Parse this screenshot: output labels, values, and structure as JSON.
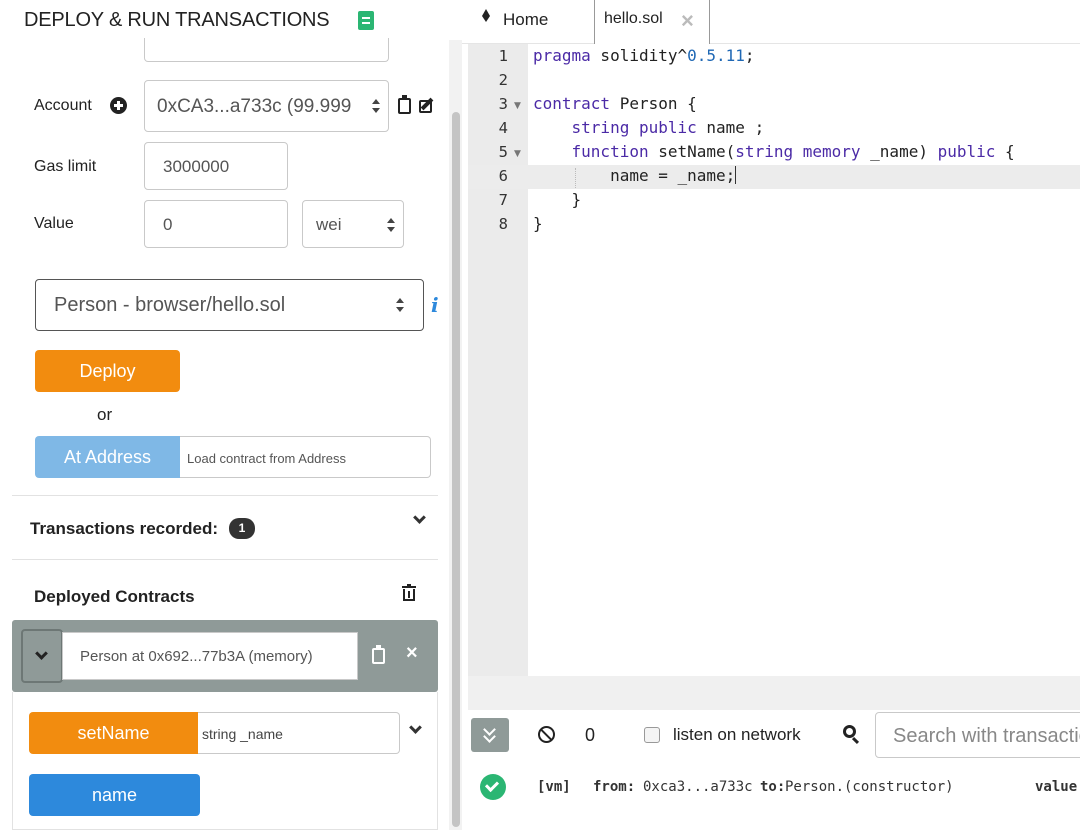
{
  "panel": {
    "title": "DEPLOY & RUN TRANSACTIONS",
    "account_label": "Account",
    "account_value": "0xCA3...a733c (99.999",
    "gas_limit_label": "Gas limit",
    "gas_limit_value": "3000000",
    "value_label": "Value",
    "value_amount": "0",
    "value_unit": "wei",
    "contract_select": "Person - browser/hello.sol",
    "deploy_button": "Deploy",
    "or_text": "or",
    "at_address_button": "At Address",
    "at_address_placeholder": "Load contract from Address",
    "transactions_recorded_label": "Transactions recorded:",
    "transactions_recorded_count": "1",
    "deployed_contracts_label": "Deployed Contracts",
    "deployed_instance": "Person at 0x692...77b3A (memory)",
    "setname_button": "setName",
    "setname_placeholder": "string _name",
    "name_button": "name"
  },
  "tabs": [
    {
      "label": "Home"
    },
    {
      "label": "hello.sol"
    }
  ],
  "editor": {
    "line_numbers": [
      "1",
      "2",
      "3",
      "4",
      "5",
      "6",
      "7",
      "8"
    ],
    "lines": [
      "pragma solidity^0.5.11;",
      "",
      "contract Person {",
      "    string public name ;",
      "    function setName(string memory _name) public {",
      "        name = _name;",
      "    }",
      "}"
    ],
    "active_line": 6
  },
  "terminal": {
    "pending_count": "0",
    "listen_label": "listen on network",
    "search_placeholder": "Search with transaction hash or address",
    "log_tag": "[vm]",
    "log_from_label": "from:",
    "log_from": "0xca3...a733c",
    "log_to_label": "to:",
    "log_to": "Person.(constructor)",
    "log_value_label": "value"
  },
  "colors": {
    "accent_orange": "#f28c0f",
    "accent_blue": "#2d89dc",
    "success_green": "#2bb673"
  }
}
